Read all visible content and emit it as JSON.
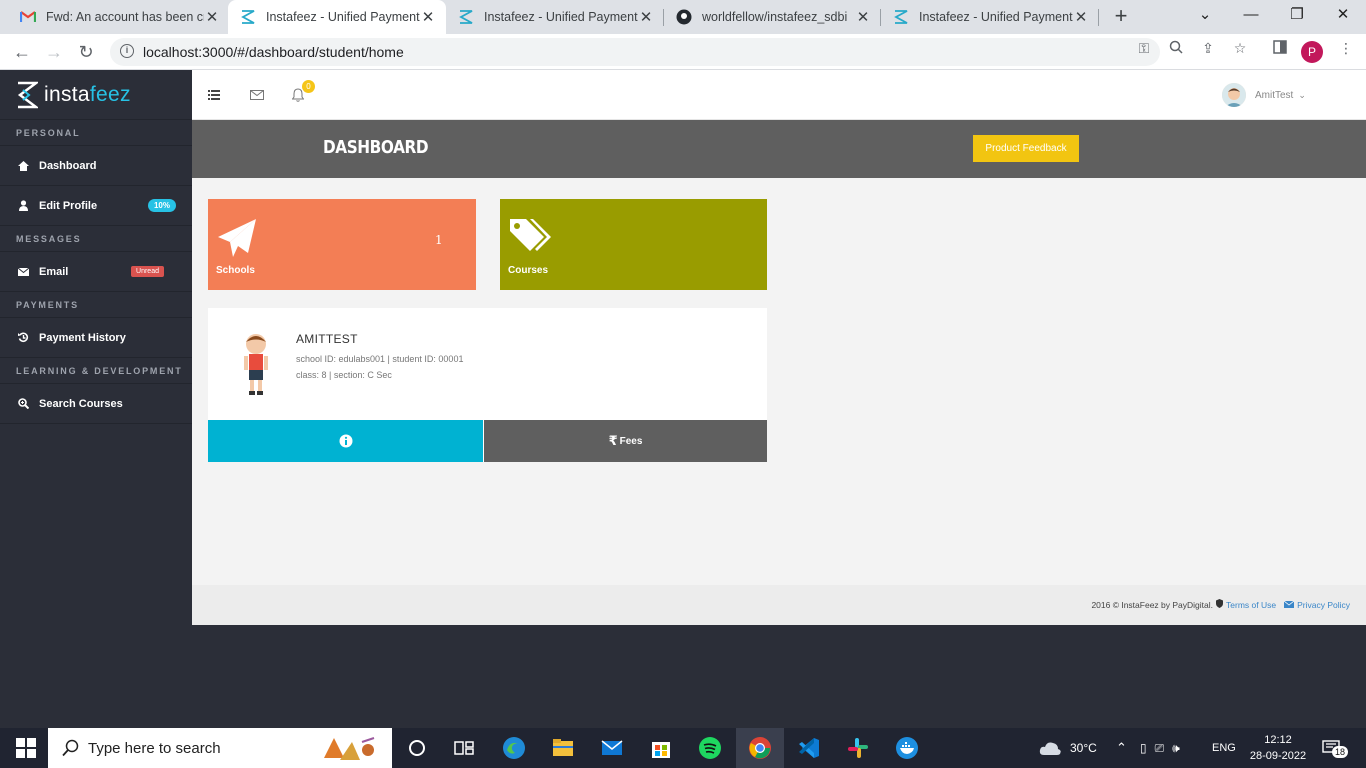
{
  "browser": {
    "tabs": [
      {
        "title": "Fwd: An account has been cr",
        "favicon": "gmail-icon",
        "active": false
      },
      {
        "title": "Instafeez - Unified Payments",
        "favicon": "instafeez-icon",
        "active": true
      },
      {
        "title": "Instafeez - Unified Payments",
        "favicon": "instafeez-icon",
        "active": false
      },
      {
        "title": "worldfellow/instafeez_sdbi",
        "favicon": "github-icon",
        "active": false
      },
      {
        "title": "Instafeez - Unified Payments",
        "favicon": "instafeez-icon",
        "active": false
      }
    ],
    "url": "localhost:3000/#/dashboard/student/home",
    "profile_initial": "P"
  },
  "app": {
    "brand": {
      "prefix": "insta",
      "suffix": "feez"
    },
    "sidebar": {
      "sections": [
        {
          "heading": "PERSONAL"
        },
        {
          "heading": "MESSAGES"
        },
        {
          "heading": "PAYMENTS"
        },
        {
          "heading": "LEARNING & DEVELOPMENT"
        }
      ],
      "items": {
        "dashboard": {
          "label": "Dashboard",
          "icon": "home-icon"
        },
        "edit_profile": {
          "label": "Edit Profile",
          "icon": "user-icon",
          "badge": "10%"
        },
        "email": {
          "label": "Email",
          "icon": "envelope-icon",
          "badge": "Unread"
        },
        "payment_history": {
          "label": "Payment History",
          "icon": "history-icon"
        },
        "search_courses": {
          "label": "Search Courses",
          "icon": "search-plus-icon"
        }
      }
    },
    "header": {
      "notification_count": "0",
      "user_name": "AmitTest"
    },
    "page": {
      "title": "DASHBOARD",
      "feedback_button": "Product Feedback"
    },
    "tiles": [
      {
        "label": "Schools",
        "count": "1",
        "color": "#f37e55",
        "icon": "paper-plane-icon"
      },
      {
        "label": "Courses",
        "count": "",
        "color": "#999c00",
        "icon": "tags-icon"
      }
    ],
    "profile": {
      "name": "AMITTEST",
      "line1": "school ID: edulabs001 | student ID: 00001",
      "line2": "class: 8 | section: C Sec",
      "fees_button": "Fees",
      "rupee_symbol": "₹"
    },
    "footer": {
      "copyright": "2016 © InstaFeez by PayDigital.",
      "terms": "Terms of Use",
      "privacy": "Privacy Policy"
    }
  },
  "taskbar": {
    "search_placeholder": "Type here to search",
    "weather": "30°C",
    "language": "ENG",
    "time": "12:12",
    "date": "28-09-2022",
    "notification_count": "18"
  }
}
